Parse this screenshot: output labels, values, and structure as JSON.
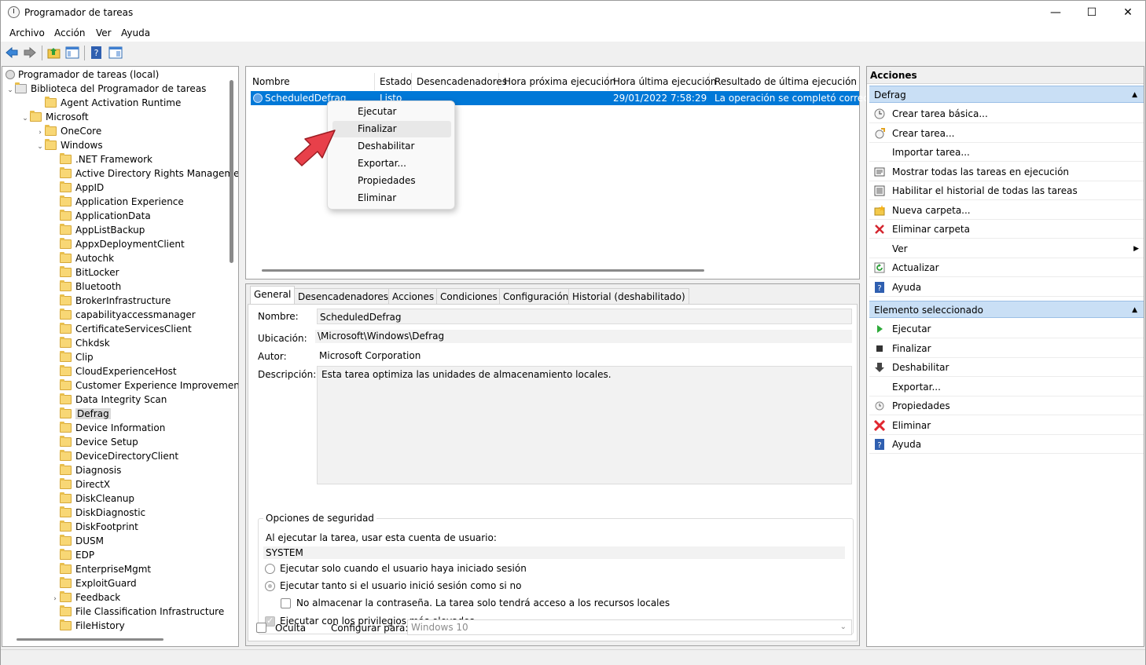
{
  "window": {
    "title": "Programador de tareas",
    "min": "—",
    "max": "☐",
    "close": "✕"
  },
  "menu": [
    "Archivo",
    "Acción",
    "Ver",
    "Ayuda"
  ],
  "tree": {
    "root": "Programador de tareas (local)",
    "library": "Biblioteca del Programador de tareas",
    "items": [
      "Agent Activation Runtime",
      "Microsoft",
      "OneCore",
      "Windows",
      ".NET Framework",
      "Active Directory Rights Manageme",
      "AppID",
      "Application Experience",
      "ApplicationData",
      "AppListBackup",
      "AppxDeploymentClient",
      "Autochk",
      "BitLocker",
      "Bluetooth",
      "BrokerInfrastructure",
      "capabilityaccessmanager",
      "CertificateServicesClient",
      "Chkdsk",
      "Clip",
      "CloudExperienceHost",
      "Customer Experience Improvemen",
      "Data Integrity Scan",
      "Defrag",
      "Device Information",
      "Device Setup",
      "DeviceDirectoryClient",
      "Diagnosis",
      "DirectX",
      "DiskCleanup",
      "DiskDiagnostic",
      "DiskFootprint",
      "DUSM",
      "EDP",
      "EnterpriseMgmt",
      "ExploitGuard",
      "Feedback",
      "File Classification Infrastructure",
      "FileHistory"
    ]
  },
  "tasklist": {
    "columns": [
      "Nombre",
      "Estado",
      "Desencadenadores",
      "Hora próxima ejecución",
      "Hora última ejecución",
      "Resultado de última ejecución"
    ],
    "row": {
      "name": "ScheduledDefrag",
      "status": "Listo",
      "last_run": "29/01/2022 7:58:29",
      "result": "La operación se completó correcta"
    }
  },
  "context_menu": [
    "Ejecutar",
    "Finalizar",
    "Deshabilitar",
    "Exportar...",
    "Propiedades",
    "Eliminar"
  ],
  "props": {
    "tabs": [
      "General",
      "Desencadenadores",
      "Acciones",
      "Condiciones",
      "Configuración",
      "Historial (deshabilitado)"
    ],
    "name_label": "Nombre:",
    "name_value": "ScheduledDefrag",
    "location_label": "Ubicación:",
    "location_value": "\\Microsoft\\Windows\\Defrag",
    "author_label": "Autor:",
    "author_value": "Microsoft Corporation",
    "desc_label": "Descripción:",
    "desc_value": "Esta tarea optimiza las unidades de almacenamiento locales.",
    "security": {
      "legend": "Opciones de seguridad",
      "account_label": "Al ejecutar la tarea, usar esta cuenta de usuario:",
      "account_value": "SYSTEM",
      "radio1": "Ejecutar solo cuando el usuario haya iniciado sesión",
      "radio2": "Ejecutar tanto si el usuario inició sesión como si no",
      "nostore": "No almacenar la contraseña. La tarea solo tendrá acceso a los recursos locales",
      "highest": "Ejecutar con los privilegios más elevados"
    },
    "hidden_label": "Oculta",
    "configure_label": "Configurar para:",
    "configure_value": "Windows 10"
  },
  "actions": {
    "header": "Acciones",
    "section1": "Defrag",
    "items1": [
      {
        "label": "Crear tarea básica...",
        "icon": "create-basic-task-icon"
      },
      {
        "label": "Crear tarea...",
        "icon": "create-task-icon"
      },
      {
        "label": "Importar tarea...",
        "icon": ""
      },
      {
        "label": "Mostrar todas las tareas en ejecución",
        "icon": "running-tasks-icon"
      },
      {
        "label": "Habilitar el historial de todas las tareas",
        "icon": "history-icon"
      },
      {
        "label": "Nueva carpeta...",
        "icon": "new-folder-icon"
      },
      {
        "label": "Eliminar carpeta",
        "icon": "delete-folder-icon"
      },
      {
        "label": "Ver",
        "icon": ""
      },
      {
        "label": "Actualizar",
        "icon": "refresh-icon"
      },
      {
        "label": "Ayuda",
        "icon": "help-icon"
      }
    ],
    "section2": "Elemento seleccionado",
    "items2": [
      {
        "label": "Ejecutar",
        "icon": "run-icon"
      },
      {
        "label": "Finalizar",
        "icon": "stop-icon"
      },
      {
        "label": "Deshabilitar",
        "icon": "disable-icon"
      },
      {
        "label": "Exportar...",
        "icon": ""
      },
      {
        "label": "Propiedades",
        "icon": "properties-icon"
      },
      {
        "label": "Eliminar",
        "icon": "delete-icon"
      },
      {
        "label": "Ayuda",
        "icon": "help-icon"
      }
    ]
  },
  "colors": {
    "selection": "#0078d7",
    "section": "#c9dff5",
    "accent_red": "#e8404a"
  }
}
